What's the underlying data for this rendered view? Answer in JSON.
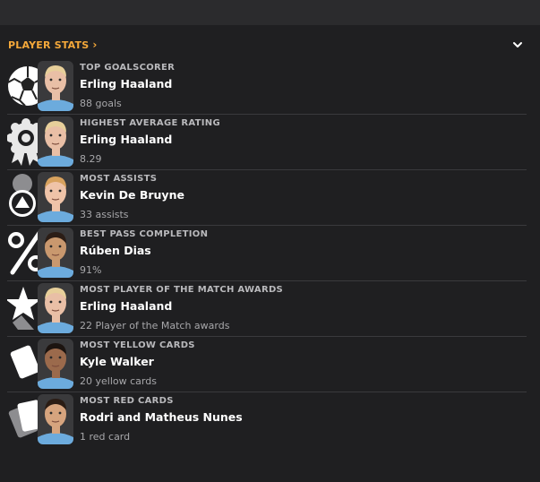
{
  "header": {
    "title": "PLAYER STATS",
    "accent_color": "#f4a83a"
  },
  "rows": [
    {
      "label": "TOP GOALSCORER",
      "player": "Erling Haaland",
      "value": "88 goals",
      "icon": "football-icon",
      "skin": "#e9bfa6",
      "hair": "#e7cf9a"
    },
    {
      "label": "HIGHEST AVERAGE RATING",
      "player": "Erling Haaland",
      "value": "8.29",
      "icon": "rosette-icon",
      "skin": "#e9bfa6",
      "hair": "#e7cf9a"
    },
    {
      "label": "MOST ASSISTS",
      "player": "Kevin De Bruyne",
      "value": "33 assists",
      "icon": "assist-icon",
      "skin": "#efc3a8",
      "hair": "#d8a25e"
    },
    {
      "label": "BEST PASS COMPLETION",
      "player": "Rúben Dias",
      "value": "91%",
      "icon": "percent-icon",
      "skin": "#c9986e",
      "hair": "#2b1d16"
    },
    {
      "label": "MOST PLAYER OF THE MATCH AWARDS",
      "player": "Erling Haaland",
      "value": "22 Player of the Match awards",
      "icon": "star-icon",
      "skin": "#e9bfa6",
      "hair": "#e7cf9a"
    },
    {
      "label": "MOST YELLOW CARDS",
      "player": "Kyle Walker",
      "value": "20 yellow cards",
      "icon": "yellow-card-icon",
      "skin": "#9b6a4c",
      "hair": "#1c1410"
    },
    {
      "label": "MOST RED CARDS",
      "player": "Rodri and Matheus Nunes",
      "value": "1 red card",
      "icon": "red-card-icon",
      "skin": "#d6a47e",
      "hair": "#2a1c14"
    }
  ]
}
